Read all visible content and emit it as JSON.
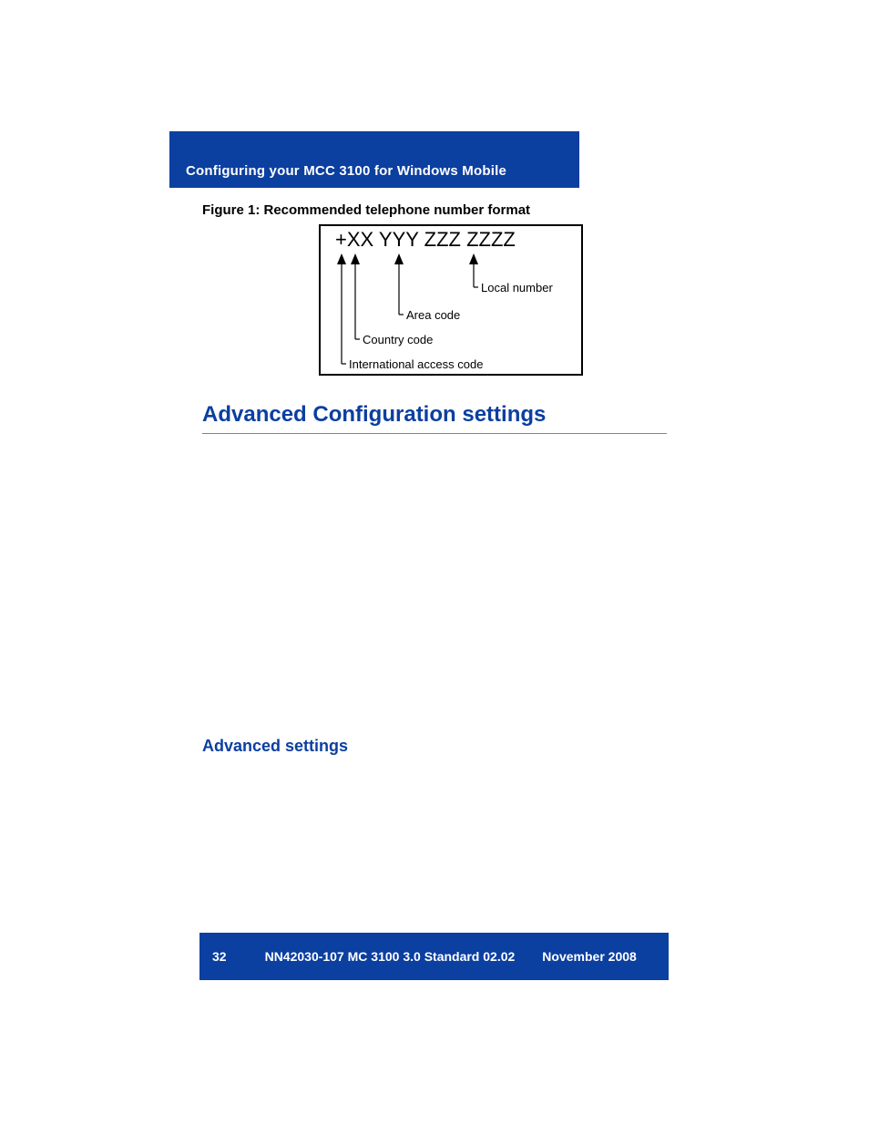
{
  "header": {
    "title": "Configuring your MCC 3100 for Windows Mobile"
  },
  "figure": {
    "caption": "Figure 1: Recommended telephone number format",
    "format_string": "+XX YYY ZZZ ZZZZ",
    "labels": {
      "local": "Local number",
      "area": "Area code",
      "country": "Country code",
      "intl": "International access code"
    }
  },
  "section": {
    "heading": "Advanced Configuration settings",
    "subheading": "Advanced settings"
  },
  "footer": {
    "page_number": "32",
    "doc_id": "NN42030-107 MC 3100  3.0 Standard 02.02",
    "date": "November 2008"
  }
}
